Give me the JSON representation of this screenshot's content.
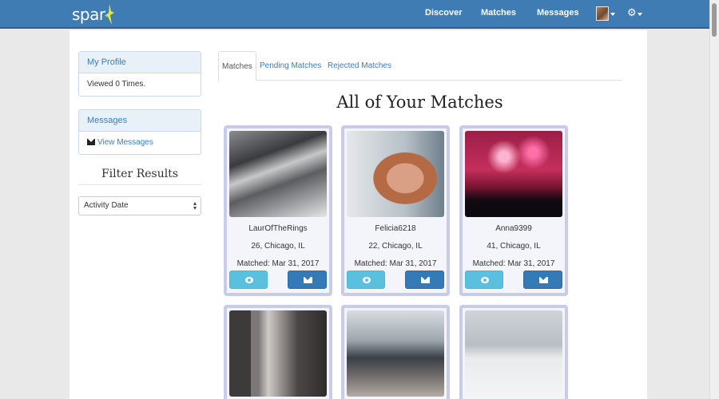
{
  "nav": {
    "logo_text": "spar",
    "links": [
      {
        "label": "Discover"
      },
      {
        "label": "Matches"
      },
      {
        "label": "Messages"
      }
    ]
  },
  "sidebar": {
    "profile": {
      "heading": "My Profile",
      "body": "Viewed 0 Times."
    },
    "messages": {
      "heading": "Messages",
      "link": "View Messages"
    },
    "filter_title": "Filter Results",
    "filter_select": "Activity Date"
  },
  "tabs": [
    {
      "label": "Matches",
      "active": true
    },
    {
      "label": "Pending Matches",
      "active": false
    },
    {
      "label": "Rejected Matches",
      "active": false
    }
  ],
  "main_title": "All of Your Matches",
  "matches": [
    {
      "username": "LaurOfTheRings",
      "details": "26, Chicago, IL",
      "matched": "Matched: Mar 31, 2017"
    },
    {
      "username": "Felicia6218",
      "details": "22, Chicago, IL",
      "matched": "Matched: Mar 31, 2017"
    },
    {
      "username": "Anna9399",
      "details": "41, Chicago, IL",
      "matched": "Matched: Mar 31, 2017"
    }
  ],
  "colors": {
    "navbar": "#3f7cb3",
    "view_button": "#5bc0de",
    "message_button": "#337ab7",
    "card_border": "#c9cce9"
  }
}
